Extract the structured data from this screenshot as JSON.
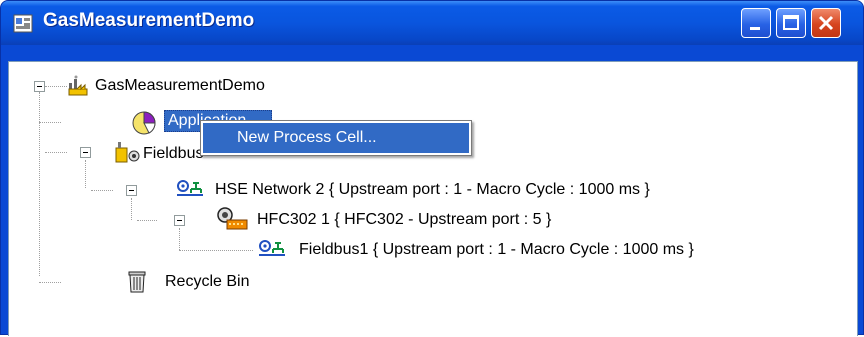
{
  "window": {
    "title": "GasMeasurementDemo",
    "buttons": {
      "minimize": "minimize",
      "maximize": "maximize",
      "close": "close"
    }
  },
  "tree": {
    "root": {
      "label": "GasMeasurementDemo",
      "icon": "plant-icon",
      "expander": "−"
    },
    "application": {
      "label": "Application",
      "icon": "pie-chart-icon"
    },
    "fieldbus_networks": {
      "label": "Fieldbus Networks",
      "icon": "network-root-icon",
      "expander": "−"
    },
    "hse_network": {
      "label": "HSE Network 2 { Upstream port : 1 -  Macro Cycle : 1000 ms  }",
      "icon": "network-icon",
      "expander": "−"
    },
    "hfc302": {
      "label": "HFC302 1 { HFC302 -  Upstream port : 5 }",
      "icon": "device-icon",
      "expander": "−"
    },
    "fieldbus1": {
      "label": "Fieldbus1 { Upstream port : 1 -  Macro Cycle : 1000 ms  }",
      "icon": "network-icon"
    },
    "recycle_bin": {
      "label": "Recycle Bin",
      "icon": "trash-icon"
    }
  },
  "context_menu": {
    "items": [
      {
        "label": "New Process Cell..."
      }
    ]
  },
  "colors": {
    "title_bar": "#0a55de",
    "selection": "#316ac5"
  }
}
